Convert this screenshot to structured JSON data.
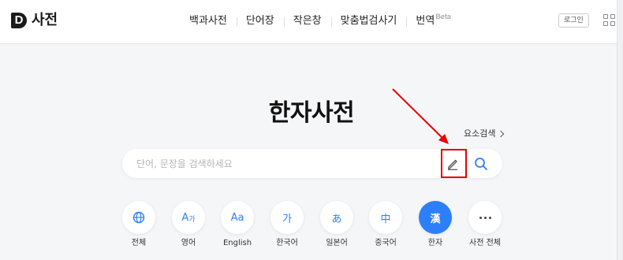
{
  "header": {
    "logo_letter": "D",
    "logo_text": "사전",
    "nav": [
      {
        "label": "백과사전"
      },
      {
        "label": "단어장"
      },
      {
        "label": "작은창"
      },
      {
        "label": "맞춤법검사기"
      },
      {
        "label": "번역",
        "badge": "Beta"
      }
    ],
    "login_label": "로그인"
  },
  "main": {
    "title": "한자사전",
    "radical_search_label": "요소검색",
    "search": {
      "placeholder": "단어, 문장을 검색하세요",
      "value": ""
    }
  },
  "categories": [
    {
      "label": "전체",
      "icon": "globe-icon"
    },
    {
      "label": "영어",
      "icon_text": "A가"
    },
    {
      "label": "English",
      "icon_text": "Aa"
    },
    {
      "label": "한국어",
      "icon_text": "가"
    },
    {
      "label": "일본어",
      "icon_text": "あ"
    },
    {
      "label": "중국어",
      "icon_text": "中"
    },
    {
      "label": "한자",
      "icon_text": "漢",
      "active": true
    },
    {
      "label": "사전 전체",
      "icon": "more-icon"
    }
  ],
  "colors": {
    "accent": "#2d7ff9",
    "highlight": "#e60000"
  }
}
